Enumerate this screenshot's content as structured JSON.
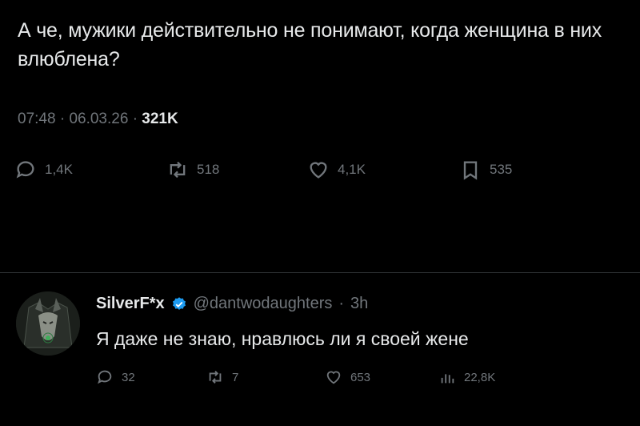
{
  "tweet": {
    "text": "А че, мужики действительно не понимают, когда женщина в них влюблена?",
    "time": "07:48",
    "date": "06.03.26",
    "views": "321K",
    "separator": "·"
  },
  "actions": {
    "replies": "1,4K",
    "reposts": "518",
    "likes": "4,1K",
    "bookmarks": "535"
  },
  "reply": {
    "name": "SilverF*x",
    "handle": "@dantwodaughters",
    "time": "3h",
    "text": "Я даже не знаю, нравлюсь ли я своей жене",
    "replies": "32",
    "reposts": "7",
    "likes": "653",
    "views": "22,8K"
  },
  "colors": {
    "background": "#000000",
    "text": "#e7e9ea",
    "muted": "#71767b",
    "verified": "#1d9bf0"
  }
}
